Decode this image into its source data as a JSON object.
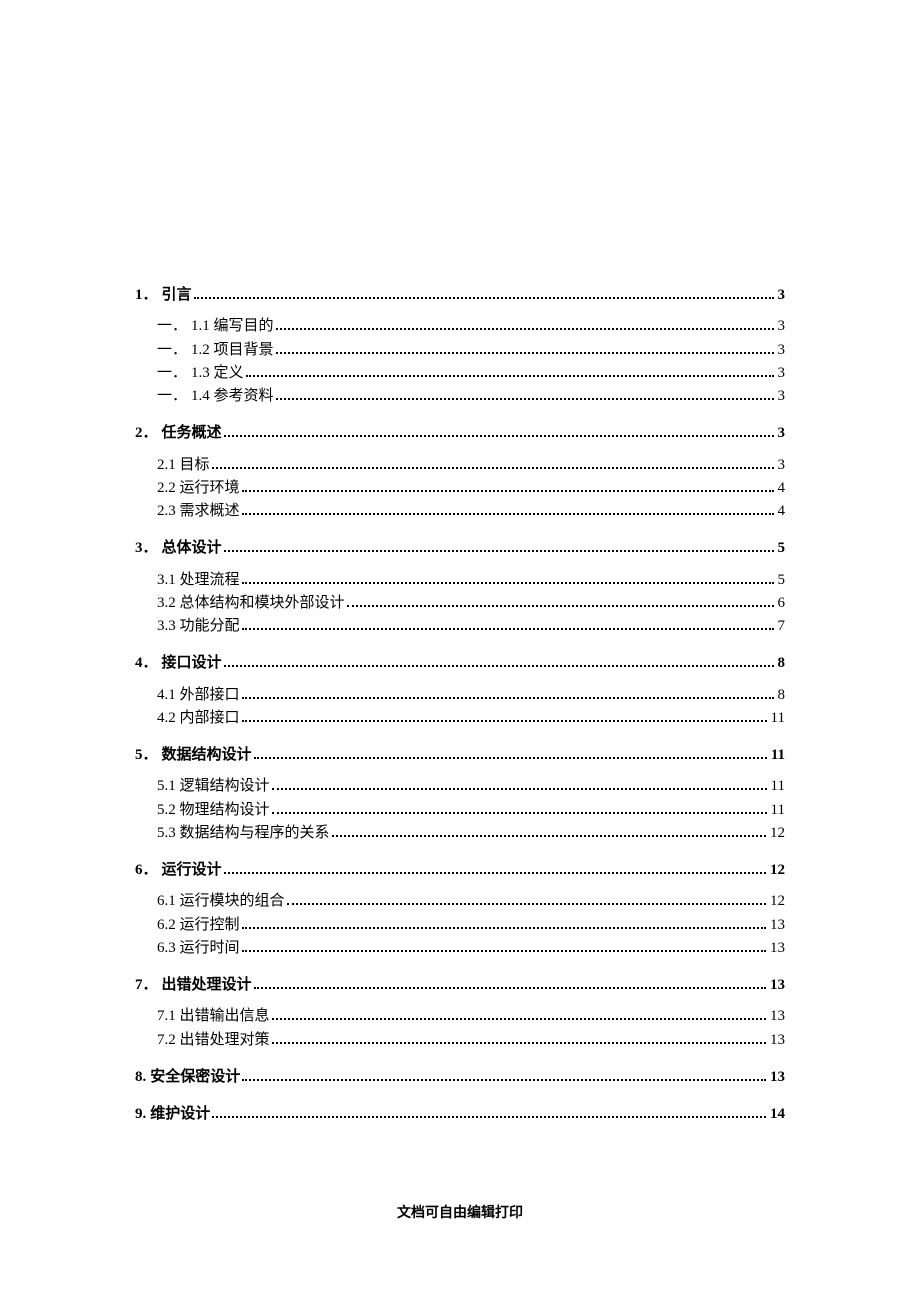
{
  "footer": "文档可自由编辑打印",
  "toc": [
    {
      "level": 1,
      "prefix": "1．",
      "title": "引言",
      "page": "3"
    },
    {
      "level": 2,
      "prefix": "一．",
      "title": "1.1 编写目的",
      "page": "3"
    },
    {
      "level": 2,
      "prefix": "一．",
      "title": "1.2 项目背景",
      "page": "3"
    },
    {
      "level": 2,
      "prefix": "一．",
      "title": "1.3 定义",
      "page": "3"
    },
    {
      "level": 2,
      "prefix": "一．",
      "title": "1.4 参考资料",
      "page": "3"
    },
    {
      "level": 1,
      "prefix": "2．",
      "title": "任务概述",
      "page": "3"
    },
    {
      "level": 2,
      "prefix": "",
      "title": "2.1 目标",
      "page": "3"
    },
    {
      "level": 2,
      "prefix": "",
      "title": "2.2 运行环境",
      "page": "4"
    },
    {
      "level": 2,
      "prefix": "",
      "title": "2.3 需求概述",
      "page": "4"
    },
    {
      "level": 1,
      "prefix": "3．",
      "title": "总体设计",
      "page": "5"
    },
    {
      "level": 2,
      "prefix": "",
      "title": "3.1 处理流程",
      "page": "5"
    },
    {
      "level": 2,
      "prefix": "",
      "title": "3.2 总体结构和模块外部设计",
      "page": "6"
    },
    {
      "level": 2,
      "prefix": "",
      "title": "3.3 功能分配",
      "page": "7"
    },
    {
      "level": 1,
      "prefix": "4．",
      "title": "接口设计",
      "page": "8"
    },
    {
      "level": 2,
      "prefix": "",
      "title": "4.1 外部接口",
      "page": "8"
    },
    {
      "level": 2,
      "prefix": "",
      "title": "4.2 内部接口",
      "page": "11"
    },
    {
      "level": 1,
      "prefix": "5．",
      "title": "数据结构设计",
      "page": "11"
    },
    {
      "level": 2,
      "prefix": "",
      "title": "5.1 逻辑结构设计",
      "page": "11"
    },
    {
      "level": 2,
      "prefix": "",
      "title": "5.2 物理结构设计",
      "page": "11"
    },
    {
      "level": 2,
      "prefix": "",
      "title": "5.3 数据结构与程序的关系",
      "page": "12"
    },
    {
      "level": 1,
      "prefix": "6．",
      "title": "运行设计",
      "page": "12"
    },
    {
      "level": 2,
      "prefix": "",
      "title": "6.1 运行模块的组合",
      "page": "12"
    },
    {
      "level": 2,
      "prefix": "",
      "title": "6.2 运行控制",
      "page": "13"
    },
    {
      "level": 2,
      "prefix": "",
      "title": "6.3 运行时间",
      "page": "13"
    },
    {
      "level": 1,
      "prefix": "7．",
      "title": "出错处理设计",
      "page": "13"
    },
    {
      "level": 2,
      "prefix": "",
      "title": "7.1 出错输出信息",
      "page": "13"
    },
    {
      "level": 2,
      "prefix": "",
      "title": "7.2 出错处理对策",
      "page": "13"
    },
    {
      "level": 1,
      "prefix": "8.",
      "title": "安全保密设计",
      "page": "13"
    },
    {
      "level": 1,
      "prefix": "9.",
      "title": "维护设计",
      "page": "14"
    }
  ]
}
